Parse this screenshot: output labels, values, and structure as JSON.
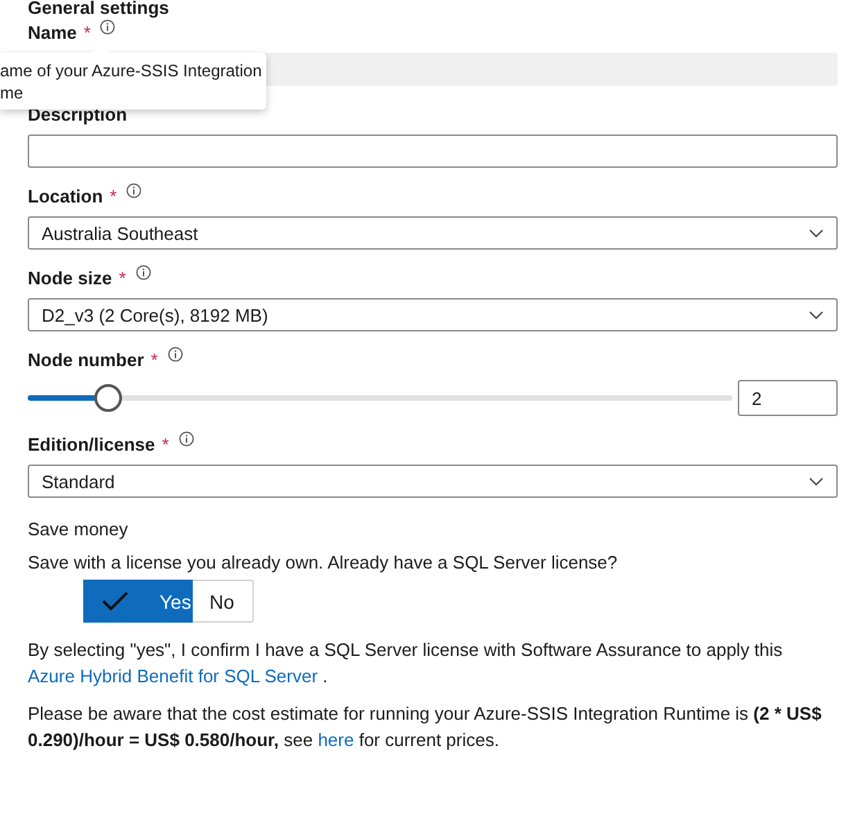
{
  "section_title": "General settings",
  "fields": [
    {
      "kind": "text",
      "label": "Name",
      "required_mark": "*",
      "info": true,
      "disabled": true
    },
    {
      "kind": "text",
      "label": "Description"
    },
    {
      "kind": "select",
      "label": "Location",
      "required_mark": "*",
      "info": true,
      "value": "Australia Southeast"
    },
    {
      "kind": "select",
      "label": "Node size",
      "required_mark": "*",
      "info": true,
      "value": "D2_v3 (2 Core(s), 8192 MB)"
    },
    {
      "kind": "slider",
      "label": "Node number",
      "required_mark": "*",
      "info": true,
      "level": 0.114,
      "value": "2"
    },
    {
      "kind": "select",
      "label": "Edition/license",
      "required_mark": "*",
      "info": true,
      "value": "Standard"
    }
  ],
  "tooltip": {
    "lines": [
      "ame of your Azure-SSIS Integration",
      "me"
    ]
  },
  "save_money": {
    "title": "Save money",
    "question": "Save with a license you already own. Already have a SQL Server license?",
    "options": [
      {
        "label": "Yes",
        "selected": true
      },
      {
        "label": "No",
        "selected": false
      }
    ]
  },
  "notes": [
    {
      "parts": [
        {
          "kind": "text",
          "text": "By selecting \"yes\", I confirm I have a SQL Server license with Software Assurance to apply this "
        },
        {
          "kind": "link",
          "text": "Azure Hybrid Benefit for SQL Server"
        },
        {
          "kind": "text",
          "text": " ."
        }
      ]
    },
    {
      "parts": [
        {
          "kind": "text",
          "text": "Please be aware that the cost estimate for running your Azure-SSIS Integration Runtime is **(2 * US$ 0.290)/hour = US$ 0.580/hour,** see "
        },
        {
          "kind": "link",
          "text": "here"
        },
        {
          "kind": "text",
          "text": " for current prices."
        }
      ]
    }
  ]
}
